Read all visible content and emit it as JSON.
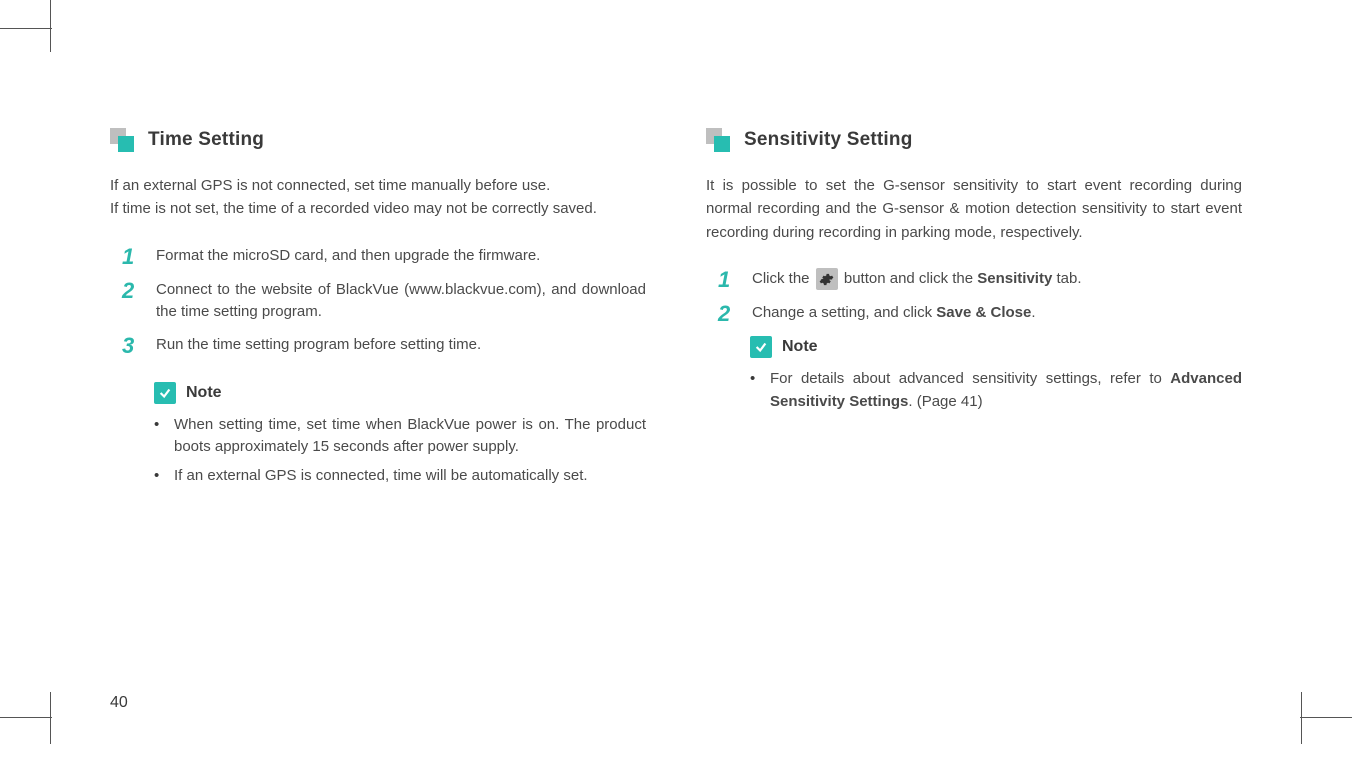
{
  "page_number": "40",
  "left": {
    "title": "Time Setting",
    "intro_line1": "If an external GPS is not connected, set time manually before use.",
    "intro_line2": "If time is not set, the time of a recorded video may not be correctly saved.",
    "steps": [
      {
        "num": "1",
        "text": "Format the microSD card, and then upgrade the firmware."
      },
      {
        "num": "2",
        "text": "Connect to the website of BlackVue (www.blackvue.com), and download the time setting program."
      },
      {
        "num": "3",
        "text": "Run the time setting program before setting time."
      }
    ],
    "note_label": "Note",
    "notes": [
      "When setting time, set time when BlackVue power is on. The product boots approximately 15 seconds after power supply.",
      "If an external GPS is connected, time will be automatically set."
    ]
  },
  "right": {
    "title": "Sensitivity Setting",
    "intro": "It is possible to set the G-sensor sensitivity to start event recording during normal recording and the G-sensor & motion detection sensitivity to start event recording during recording in parking mode, respectively.",
    "steps": [
      {
        "num": "1",
        "pre": "Click the ",
        "post": " button and click the ",
        "bold": "Sensitivity",
        "tail": " tab."
      },
      {
        "num": "2",
        "pre": "Change a setting, and click ",
        "bold": "Save & Close",
        "tail": "."
      }
    ],
    "note_label": "Note",
    "note_pre": "For details about advanced sensitivity settings, refer to ",
    "note_bold": "Advanced Sensitivity Settings",
    "note_tail": ". (Page 41)"
  }
}
